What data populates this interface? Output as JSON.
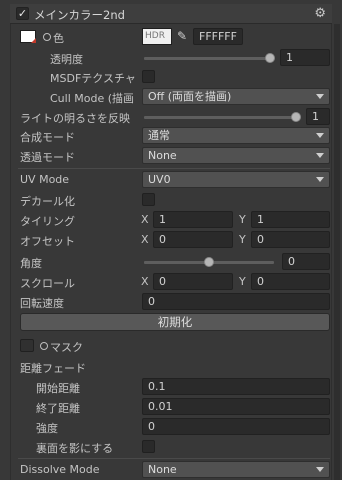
{
  "header": {
    "title": "メインカラー2nd",
    "checked": "✓"
  },
  "color_row": {
    "label": "色",
    "hdr_label": "HDR",
    "hex_value": "FFFFFF",
    "swatch_color": "#FFFFFF"
  },
  "transparency": {
    "label": "透明度",
    "value": "1",
    "slider_fraction": 1.0
  },
  "msdf": {
    "label": "MSDFテクスチャ"
  },
  "cull": {
    "label": "Cull Mode (描画",
    "value": "Off (両面を描画)"
  },
  "light": {
    "label": "ライトの明るさを反映",
    "value": "1",
    "slider_fraction": 1.0
  },
  "blend": {
    "label": "合成モード",
    "value": "通常"
  },
  "transparent_mode": {
    "label": "透過モード",
    "value": "None"
  },
  "uv_mode": {
    "label": "UV Mode",
    "value": "UV0"
  },
  "decal": {
    "label": "デカール化"
  },
  "tiling": {
    "label": "タイリング",
    "x_label": "X",
    "x_value": "1",
    "y_label": "Y",
    "y_value": "1"
  },
  "offset": {
    "label": "オフセット",
    "x_label": "X",
    "x_value": "0",
    "y_label": "Y",
    "y_value": "0"
  },
  "angle": {
    "label": "角度",
    "value": "0",
    "slider_fraction": 0.5
  },
  "scroll": {
    "label": "スクロール",
    "x_label": "X",
    "x_value": "0",
    "y_label": "Y",
    "y_value": "0"
  },
  "rotation_speed": {
    "label": "回転速度",
    "value": "0"
  },
  "reset_button": {
    "label": "初期化"
  },
  "mask": {
    "label": "マスク"
  },
  "distance_fade": {
    "label": "距離フェード"
  },
  "fade_start": {
    "label": "開始距離",
    "value": "0.1"
  },
  "fade_end": {
    "label": "終了距離",
    "value": "0.01"
  },
  "fade_strength": {
    "label": "強度",
    "value": "0"
  },
  "backface_shadow": {
    "label": "裏面を影にする"
  },
  "dissolve": {
    "label": "Dissolve Mode",
    "value": "None"
  }
}
